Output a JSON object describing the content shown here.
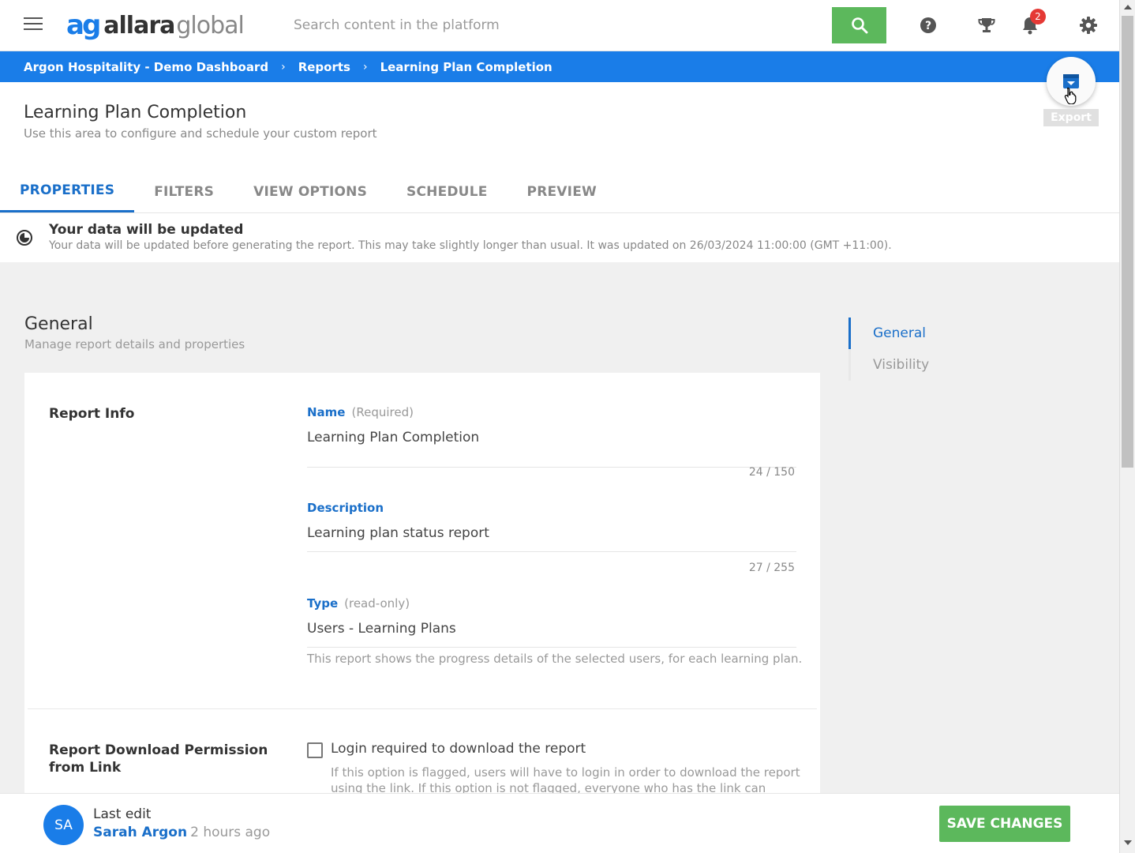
{
  "topbar": {
    "logo_mark": "ag",
    "logo_word1": "allara",
    "logo_word2": "global",
    "search_placeholder": "Search content in the platform",
    "notification_count": "2",
    "icons": [
      "menu-icon",
      "search-icon",
      "help-icon",
      "trophy-icon",
      "bell-icon",
      "gear-icon"
    ]
  },
  "breadcrumb": {
    "items": [
      "Argon Hospitality - Demo Dashboard",
      "Reports",
      "Learning Plan Completion"
    ]
  },
  "header": {
    "title": "Learning Plan Completion",
    "subtitle": "Use this area to configure and schedule your custom report",
    "export_label": "Export"
  },
  "tabs": [
    {
      "label": "PROPERTIES",
      "active": true
    },
    {
      "label": "FILTERS",
      "active": false
    },
    {
      "label": "VIEW OPTIONS",
      "active": false
    },
    {
      "label": "SCHEDULE",
      "active": false
    },
    {
      "label": "PREVIEW",
      "active": false
    }
  ],
  "notice": {
    "title": "Your data will be updated",
    "text": "Your data will be updated before generating the report. This may take slightly longer than usual. It was updated on 26/03/2024 11:00:00 (GMT +11:00)."
  },
  "section": {
    "title": "General",
    "subtitle": "Manage report details and properties"
  },
  "report_info": {
    "label": "Report Info",
    "name_label": "Name",
    "name_hint": "(Required)",
    "name_value": "Learning Plan Completion",
    "name_counter": "24 / 150",
    "desc_label": "Description",
    "desc_value": "Learning plan status report",
    "desc_counter": "27 / 255",
    "type_label": "Type",
    "type_hint": "(read-only)",
    "type_value": "Users - Learning Plans",
    "type_desc": "This report shows the progress details of the selected users, for each learning plan."
  },
  "download_permission": {
    "label": "Report Download Permission from Link",
    "checkbox_label": "Login required to download the report",
    "checkbox_desc": "If this option is flagged, users will have to login in order to download the report using the link. If this option is not flagged, everyone who has the link can"
  },
  "sidenav": {
    "items": [
      {
        "label": "General",
        "active": true
      },
      {
        "label": "Visibility",
        "active": false
      }
    ]
  },
  "footer": {
    "avatar_initials": "SA",
    "last_edit_label": "Last edit",
    "editor_name": "Sarah Argon",
    "edit_time": "2 hours ago",
    "save_label": "SAVE CHANGES"
  },
  "colors": {
    "brand_blue": "#1a7de8",
    "active_blue": "#1a6fc9",
    "green": "#5cb85c",
    "badge_red": "#e53935"
  }
}
